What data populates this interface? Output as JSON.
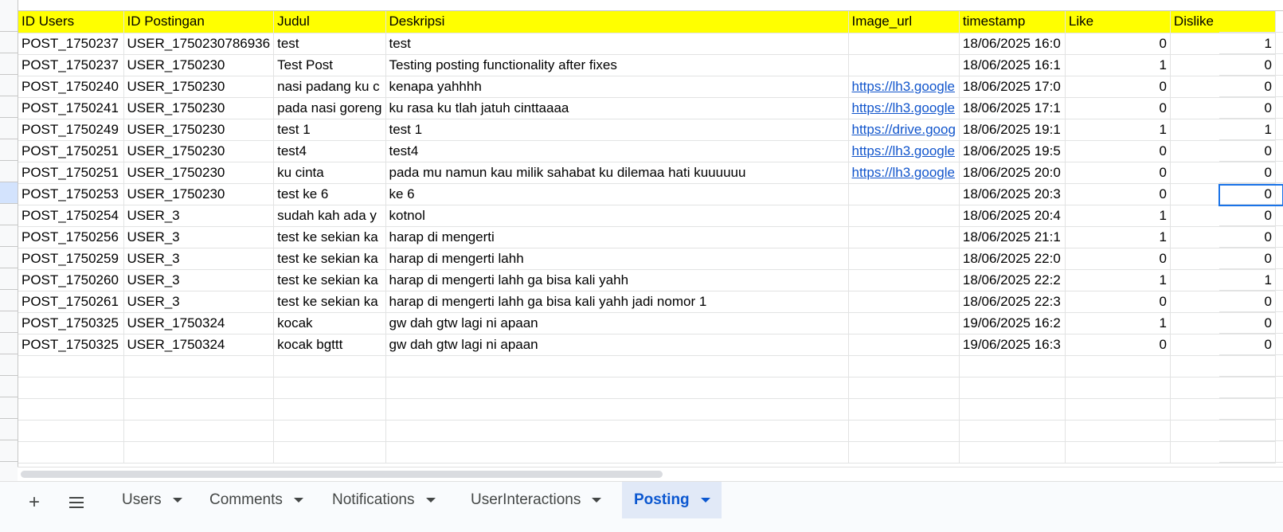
{
  "sheet": {
    "columns": [
      "ID Users",
      "ID Postingan",
      "Judul",
      "Deskripsi",
      "Image_url",
      "timestamp",
      "Like",
      "Dislike"
    ],
    "rows": [
      [
        "POST_1750237",
        "USER_1750230786936",
        "test",
        "test",
        "",
        "18/06/2025 16:0",
        "0",
        "1"
      ],
      [
        "POST_1750237",
        "USER_1750230",
        "Test Post",
        "Testing posting functionality after fixes",
        "",
        "18/06/2025 16:1",
        "1",
        "0"
      ],
      [
        "POST_1750240",
        "USER_1750230",
        "nasi padang ku c",
        "kenapa yahhhh",
        "https://lh3.google",
        "18/06/2025 17:0",
        "0",
        "0"
      ],
      [
        "POST_1750241",
        "USER_1750230",
        "pada nasi goreng",
        "ku rasa ku tlah jatuh cinttaaaa",
        "https://lh3.google",
        "18/06/2025 17:1",
        "0",
        "0"
      ],
      [
        "POST_1750249",
        "USER_1750230",
        "test 1",
        "test 1",
        "https://drive.goog",
        "18/06/2025 19:1",
        "1",
        "1"
      ],
      [
        "POST_1750251",
        "USER_1750230",
        "test4",
        "test4",
        "https://lh3.google",
        "18/06/2025 19:5",
        "0",
        "0"
      ],
      [
        "POST_1750251",
        "USER_1750230",
        "ku cinta",
        "pada mu namun kau milik sahabat ku dilemaa hati kuuuuuu",
        "https://lh3.google",
        "18/06/2025 20:0",
        "0",
        "0"
      ],
      [
        "POST_1750253",
        "USER_1750230",
        "test ke 6",
        "ke 6",
        "",
        "18/06/2025 20:3",
        "0",
        "0"
      ],
      [
        "POST_1750254",
        "USER_3",
        "sudah kah ada y",
        "kotnol",
        "",
        "18/06/2025 20:4",
        "1",
        "0"
      ],
      [
        "POST_1750256",
        "USER_3",
        "test ke sekian ka",
        "harap di mengerti",
        "",
        "18/06/2025 21:1",
        "1",
        "0"
      ],
      [
        "POST_1750259",
        "USER_3",
        "test ke sekian ka",
        "harap di mengerti lahh",
        "",
        "18/06/2025 22:0",
        "0",
        "0"
      ],
      [
        "POST_1750260",
        "USER_3",
        "test ke sekian ka",
        "harap di mengerti lahh ga bisa kali yahh",
        "",
        "18/06/2025 22:2",
        "1",
        "1"
      ],
      [
        "POST_1750261",
        "USER_3",
        "test ke sekian ka",
        "harap di mengerti lahh ga bisa kali yahh jadi nomor 1",
        "",
        "18/06/2025 22:3",
        "0",
        "0"
      ],
      [
        "POST_1750325",
        "USER_1750324",
        "kocak",
        "gw dah gtw lagi ni apaan",
        "",
        "19/06/2025 16:2",
        "1",
        "0"
      ],
      [
        "POST_1750325",
        "USER_1750324",
        "kocak bgttt",
        "gw dah gtw lagi ni apaan",
        "",
        "19/06/2025 16:3",
        "0",
        "0"
      ]
    ],
    "empty_rows": 5
  },
  "tabs": [
    {
      "label": "Users",
      "active": false
    },
    {
      "label": "Comments",
      "active": false
    },
    {
      "label": "Notifications",
      "active": false
    },
    {
      "label": "UserInteractions",
      "active": false
    },
    {
      "label": "Posting",
      "active": true
    }
  ],
  "toolbar": {
    "add_icon": "plus-icon",
    "all_sheets_icon": "hamburger-menu-icon",
    "add_label": "+"
  },
  "colors": {
    "header_bg": "#ffff00",
    "link": "#1155cc",
    "active_tab": "#0b57d0",
    "active_tab_bg": "#e1e9f7",
    "selection": "#1a73e8"
  }
}
